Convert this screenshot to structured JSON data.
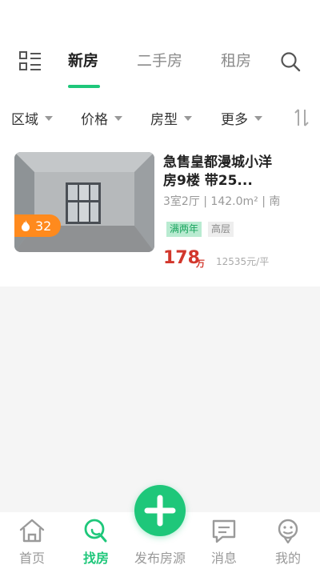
{
  "header": {
    "tabs": [
      {
        "label": "新房",
        "active": true
      },
      {
        "label": "二手房",
        "active": false
      },
      {
        "label": "租房",
        "active": false
      }
    ],
    "accent_color": "#1ec77a"
  },
  "filters": [
    {
      "label": "区域"
    },
    {
      "label": "价格"
    },
    {
      "label": "房型"
    },
    {
      "label": "更多"
    }
  ],
  "listing": {
    "title": "急售皇都漫城小洋房9楼 带25...",
    "specs": "3室2厅 | 142.0m² | 南",
    "hot_count": "32",
    "tags": [
      "满两年",
      "高层"
    ],
    "price": "178",
    "price_unit": "万",
    "unit_price": "12535元/平"
  },
  "bottom_nav": {
    "items": [
      {
        "label": "首页"
      },
      {
        "label": "找房"
      },
      {
        "label": "发布房源"
      },
      {
        "label": "消息"
      },
      {
        "label": "我的"
      }
    ],
    "active_index": 1
  }
}
